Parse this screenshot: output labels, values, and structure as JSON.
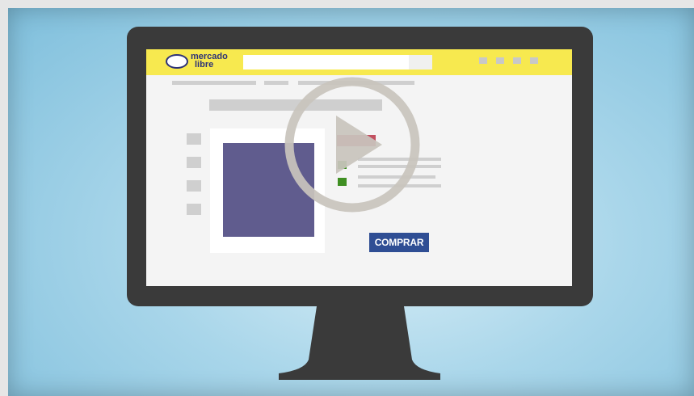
{
  "brand": {
    "logo_line1": "mercado",
    "logo_line2": "libre",
    "logo_color": "#2d3277",
    "header_color": "#f7e94f"
  },
  "product": {
    "buy_label": "COMPRAR",
    "buy_color": "#2f4e94",
    "image_color": "#605c8e",
    "price_badge_color": "#c25060",
    "bullet_color": "#3f8f22"
  },
  "video": {
    "overlay_icon": "play-icon",
    "overlay_color": "#c8c4bc"
  },
  "colors": {
    "background": "#a9d6ea",
    "monitor": "#3a3a3a",
    "screen": "#f4f4f4"
  }
}
